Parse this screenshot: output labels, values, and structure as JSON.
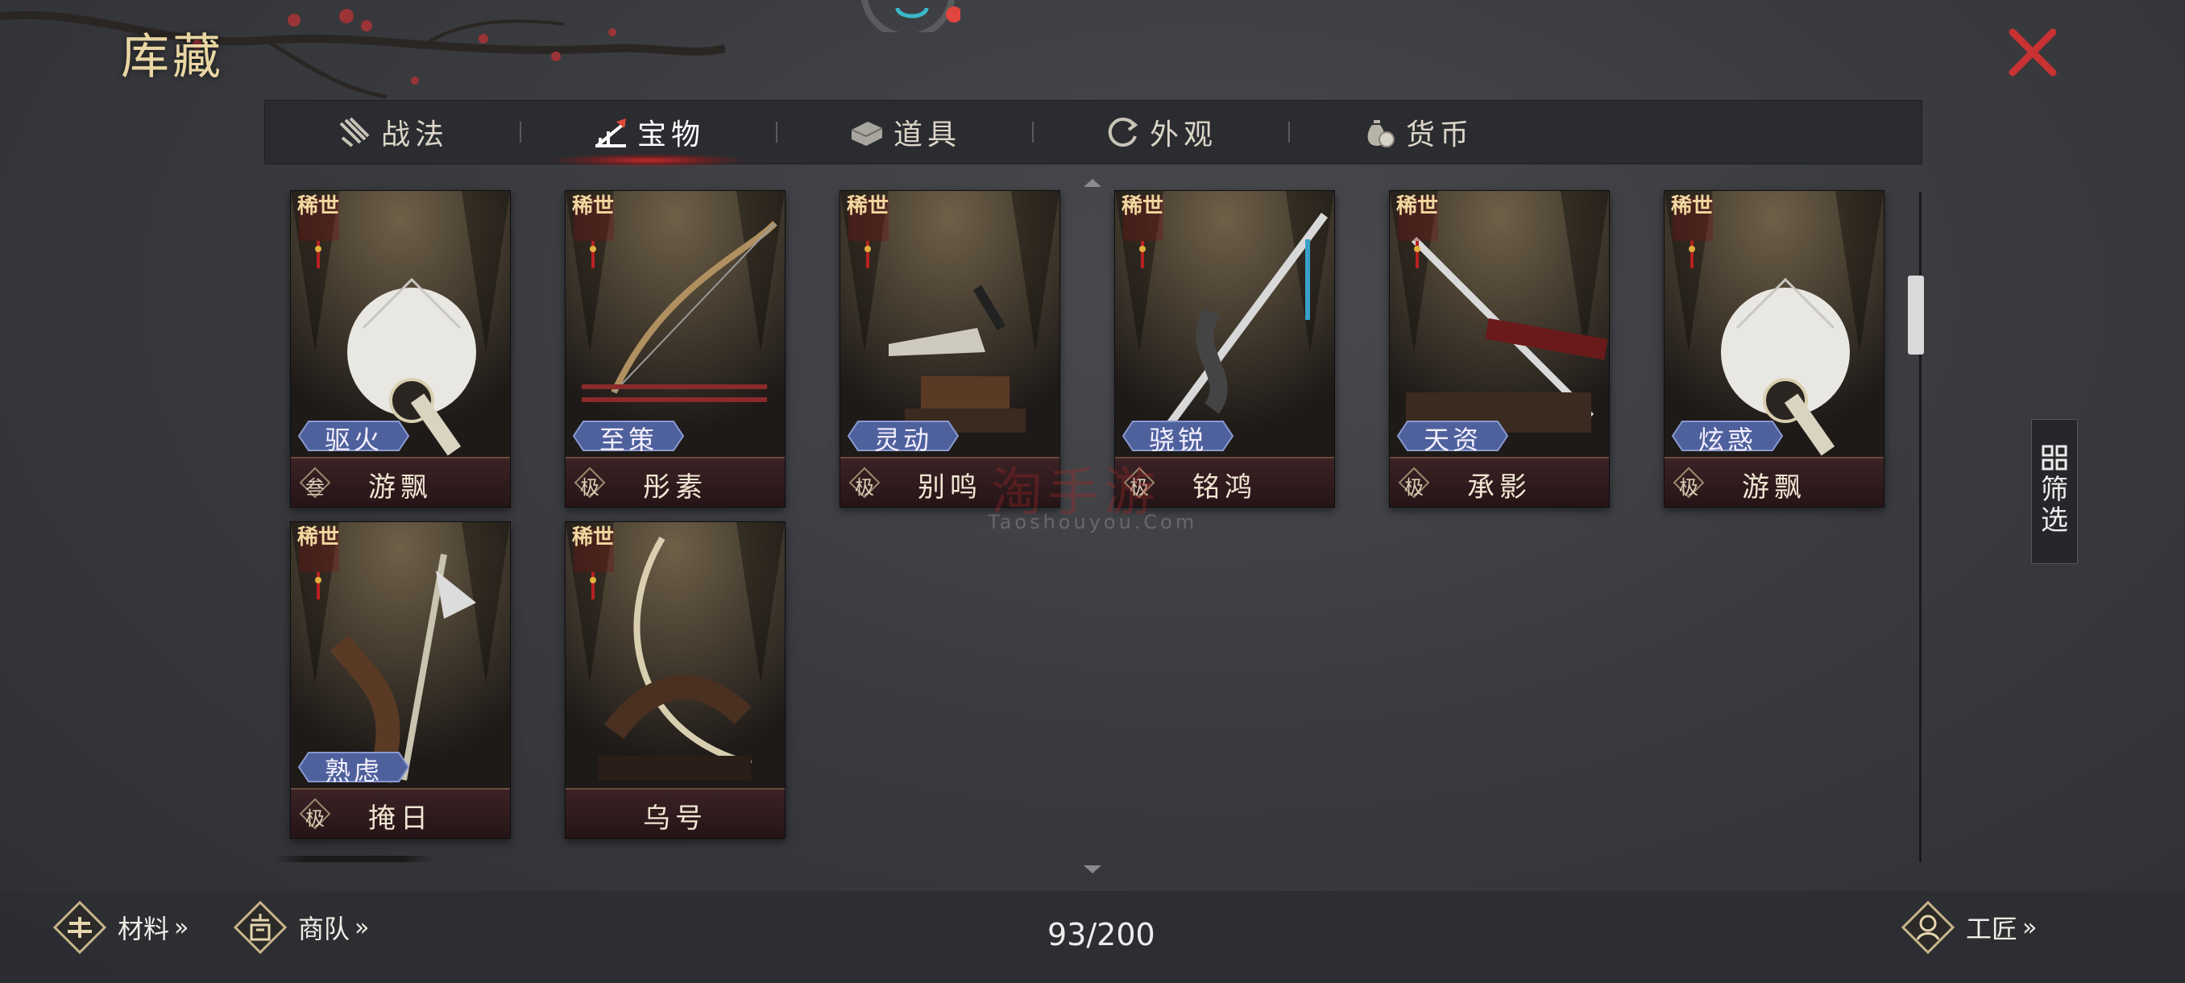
{
  "page": {
    "title": "库藏",
    "close_icon": "close-icon"
  },
  "tabs": [
    {
      "label": "战法",
      "icon": "scroll-bundle-icon",
      "active": false
    },
    {
      "label": "宝物",
      "icon": "treasure-icon",
      "active": true
    },
    {
      "label": "道具",
      "icon": "stone-icon",
      "active": false
    },
    {
      "label": "外观",
      "icon": "refresh-icon",
      "active": false
    },
    {
      "label": "货币",
      "icon": "coin-bag-icon",
      "active": false
    }
  ],
  "cards": [
    {
      "rarity": "稀世",
      "skill": "驱火",
      "grade": "叁",
      "name": "游飘",
      "art": "white-fan"
    },
    {
      "rarity": "稀世",
      "skill": "至策",
      "grade": "极",
      "name": "彤素",
      "art": "bow"
    },
    {
      "rarity": "稀世",
      "skill": "灵动",
      "grade": "极",
      "name": "别鸣",
      "art": "dagger"
    },
    {
      "rarity": "稀世",
      "skill": "骁锐",
      "grade": "极",
      "name": "铭鸿",
      "art": "dragon-sword"
    },
    {
      "rarity": "稀世",
      "skill": "天资",
      "grade": "极",
      "name": "承影",
      "art": "sword-stand"
    },
    {
      "rarity": "稀世",
      "skill": "炫惑",
      "grade": "极",
      "name": "游飘",
      "art": "white-fan"
    },
    {
      "rarity": "稀世",
      "skill": "熟虑",
      "grade": "极",
      "name": "掩日",
      "art": "halberd"
    },
    {
      "rarity": "稀世",
      "skill": "",
      "grade": "",
      "name": "乌号",
      "art": "bow-stand"
    }
  ],
  "filter": {
    "label": "筛选",
    "icon": "grid-filter-icon"
  },
  "bottom": {
    "materials": "材料",
    "caravan": "商队",
    "craftsman": "工匠",
    "chevron": "»",
    "count": "93/200"
  },
  "watermark": {
    "text": "淘手游",
    "url": "Taoshouyou.Com"
  },
  "colors": {
    "accent_red": "#c83232",
    "gold": "#e9d6a3",
    "skill_badge": "#5a6ea8"
  }
}
